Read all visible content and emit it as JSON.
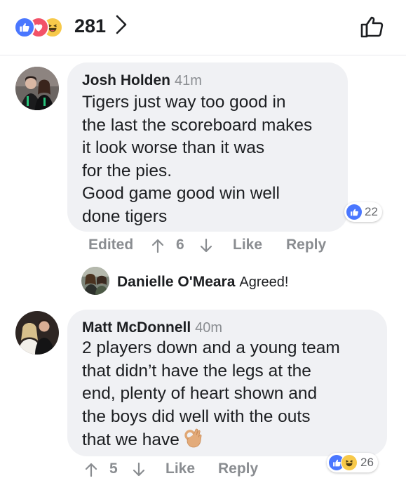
{
  "header": {
    "reaction_icons": [
      "like-icon",
      "love-icon",
      "haha-icon"
    ],
    "reaction_count": "281",
    "chevron_icon": "chevron-right-icon",
    "like_icon": "thumbs-up-outline-icon"
  },
  "comments": [
    {
      "author": "Josh Holden",
      "time": "41m",
      "lines": [
        "Tigers just way too good in",
        "the last the scoreboard makes",
        "it look worse than it was",
        "for the pies.",
        "Good game good win well",
        "done tigers"
      ],
      "reaction_count": "22",
      "actions": {
        "edited": "Edited",
        "upvotes": "6",
        "like": "Like",
        "reply": "Reply"
      },
      "reply": {
        "author": "Danielle O'Meara",
        "text": "Agreed!"
      }
    },
    {
      "author": "Matt McDonnell",
      "time": "40m",
      "lines": [
        "2 players down and a young team",
        "that didn’t have the legs at the",
        "end, plenty of heart shown and",
        "the boys did well with the outs",
        "that we have"
      ],
      "emoji": "ok-hand-emoji",
      "reaction_count": "26",
      "actions": {
        "upvotes": "5",
        "like": "Like",
        "reply": "Reply"
      }
    }
  ],
  "colors": {
    "like_blue": "#4a77ff",
    "love_red": "#f25268",
    "haha_yellow": "#f7c94a",
    "bubble_bg": "#f0f1f4",
    "meta_gray": "#8a8d91"
  }
}
